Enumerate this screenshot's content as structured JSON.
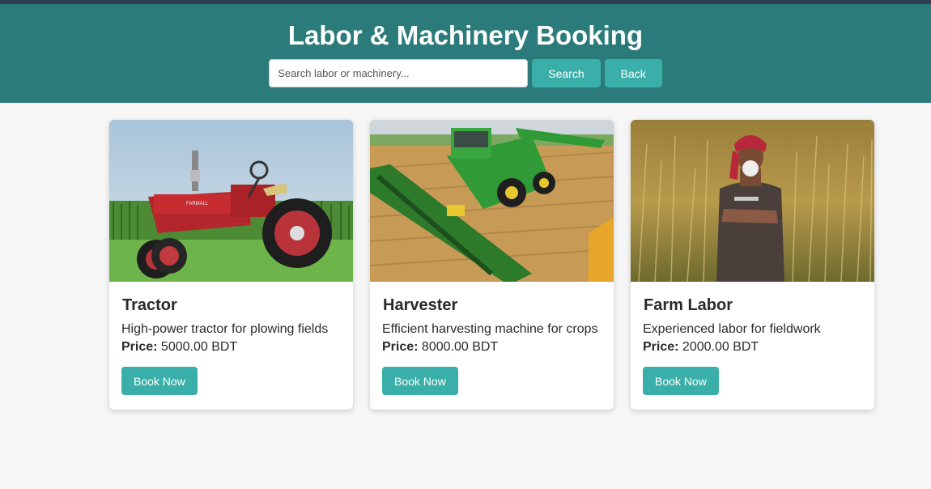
{
  "header": {
    "title": "Labor & Machinery Booking",
    "search_placeholder": "Search labor or machinery...",
    "search_button": "Search",
    "back_button": "Back"
  },
  "colors": {
    "header_bg": "#2b7b7a",
    "accent": "#3aafa9",
    "top_strip": "#2c3e50",
    "page_bg": "#f6f6f6"
  },
  "cards": [
    {
      "image": "tractor-photo",
      "title": "Tractor",
      "description": "High-power tractor for plowing fields",
      "price_label": "Price:",
      "price_value": "5000.00 BDT",
      "button": "Book Now"
    },
    {
      "image": "harvester-photo",
      "title": "Harvester",
      "description": "Efficient harvesting machine for crops",
      "price_label": "Price:",
      "price_value": "8000.00 BDT",
      "button": "Book Now"
    },
    {
      "image": "farm-labor-photo",
      "title": "Farm Labor",
      "description": "Experienced labor for fieldwork",
      "price_label": "Price:",
      "price_value": "2000.00 BDT",
      "button": "Book Now"
    }
  ]
}
